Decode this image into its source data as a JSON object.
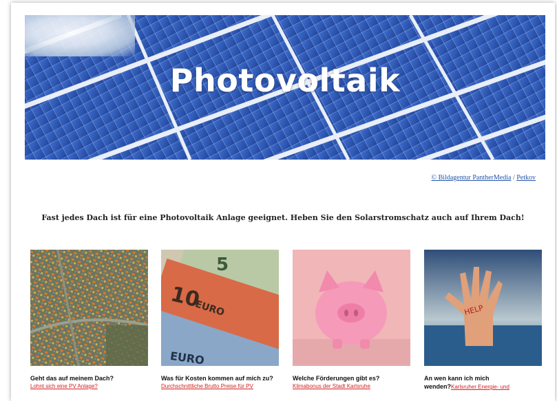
{
  "hero": {
    "title": "Photovoltaik",
    "image": "solar-panels-photo"
  },
  "credit": {
    "agency": "© Bildagentur PantherMedia",
    "separator": "/",
    "author": "Petkov"
  },
  "tagline": "Fast jedes Dach ist für eine Photovoltaik Anlage geeignet. Heben Sie den Solarstromschatz auch auf Ihrem Dach!",
  "cards": [
    {
      "image": "aerial-city-map-photo",
      "title": "Geht das auf meinem Dach?",
      "link": "Lohnt sich eine PV Anlage?"
    },
    {
      "image": "euro-banknotes-photo",
      "title": "Was für Kosten kommen auf mich zu?",
      "link": "Durchschnittliche Brutto Preise für PV"
    },
    {
      "image": "piggy-bank-photo",
      "title": "Welche Förderungen gibt es?",
      "link": "Klimabonus der Stadt Karlsruhe"
    },
    {
      "image": "help-hand-water-photo",
      "title": "An wen kann ich mich",
      "title2": "wenden?",
      "link": "Karlsruher Energie- und"
    }
  ],
  "colors": {
    "link": "#d02020",
    "credit": "#2255aa",
    "hero": "#2d5bb8"
  }
}
